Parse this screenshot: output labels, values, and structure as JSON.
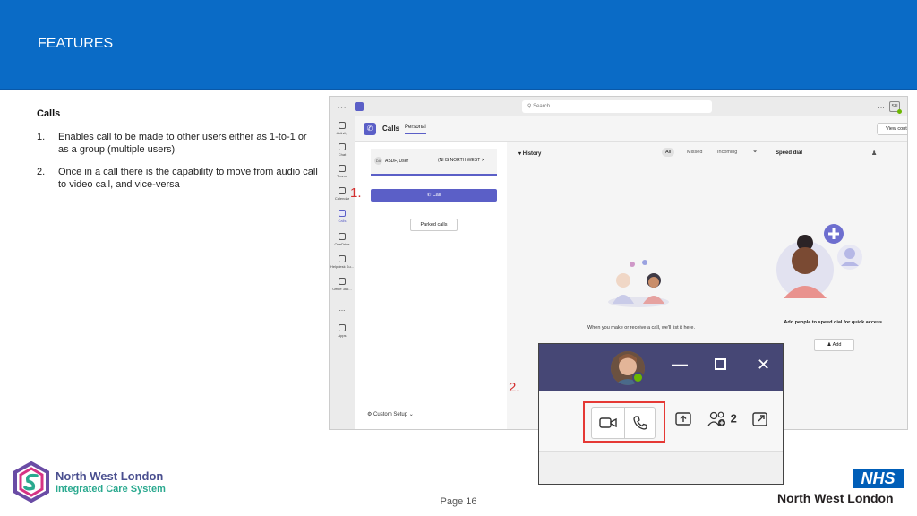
{
  "header": {
    "title": "FEATURES",
    "color": "#0a6bc6"
  },
  "content": {
    "heading": "Calls",
    "items": [
      {
        "num": "1.",
        "text": "Enables call to be made to other users either as 1-to-1 or as a group (multiple users)"
      },
      {
        "num": "2.",
        "text": "Once in a call there is the capability to move from audio call to video call, and vice-versa"
      }
    ]
  },
  "teams": {
    "search_placeholder": "Search",
    "user_initials": "SU",
    "rail": [
      "Activity",
      "Chat",
      "Teams",
      "Calendar",
      "Calls",
      "OneDrive",
      "Helpdesk Su...",
      "Office 365...",
      "...",
      "Apps"
    ],
    "calls_title": "Calls",
    "personal_tab": "Personal",
    "view_contacts": "View contacts",
    "dial_initials": "DA",
    "dial_user": "ASDF, User",
    "dial_org": "(NHS NORTH WEST",
    "call_button": "Call",
    "parked_calls": "Parked calls",
    "custom_setup": "Custom Setup",
    "history_title": "History",
    "history_tabs": [
      "All",
      "Missed",
      "Incoming"
    ],
    "history_empty": "When you make or receive a call, we'll list it here.",
    "speed_dial_title": "Speed dial",
    "speed_dial_text": "Add people to speed dial for quick access.",
    "speed_add": "Add"
  },
  "markers": {
    "one": "1.",
    "two": "2."
  },
  "call_window": {
    "participants_count": "2",
    "highlight_color": "#e53935"
  },
  "footer": {
    "org_name": "North West London",
    "org_sub": "Integrated Care System",
    "page": "Page 16",
    "nhs": "NHS",
    "nhs_region": "North West London"
  }
}
